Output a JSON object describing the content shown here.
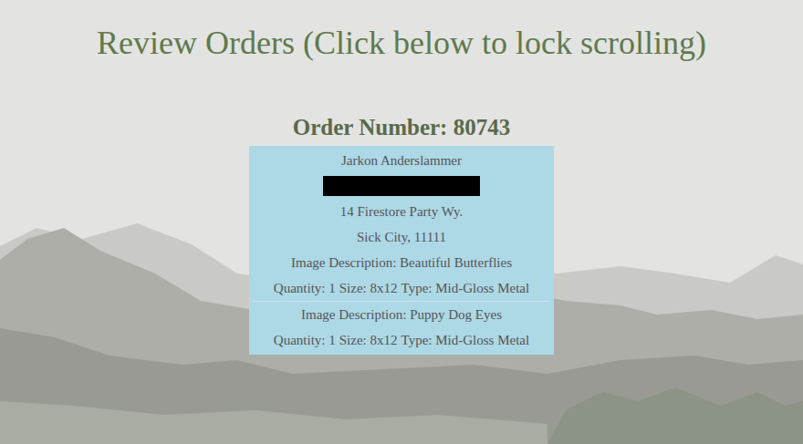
{
  "page": {
    "title": "Review Orders (Click below to lock scrolling)"
  },
  "orders": [
    {
      "heading": "Order Number: 80743",
      "customer": {
        "name": "Jarkon Anderslammer",
        "redacted": true,
        "street": "14 Firestore Party Wy.",
        "city": "Sick City, 11111"
      },
      "items": [
        {
          "description": "Image Description: Beautiful Butterflies",
          "quantity": "Quantity: 1",
          "size": "Size: 8x12",
          "type": "Type: Mid-Gloss Metal"
        },
        {
          "description": "Image Description: Puppy Dog Eyes",
          "quantity": "Quantity: 1",
          "size": "Size: 8x12",
          "type": "Type: Mid-Gloss Metal"
        }
      ]
    }
  ]
}
